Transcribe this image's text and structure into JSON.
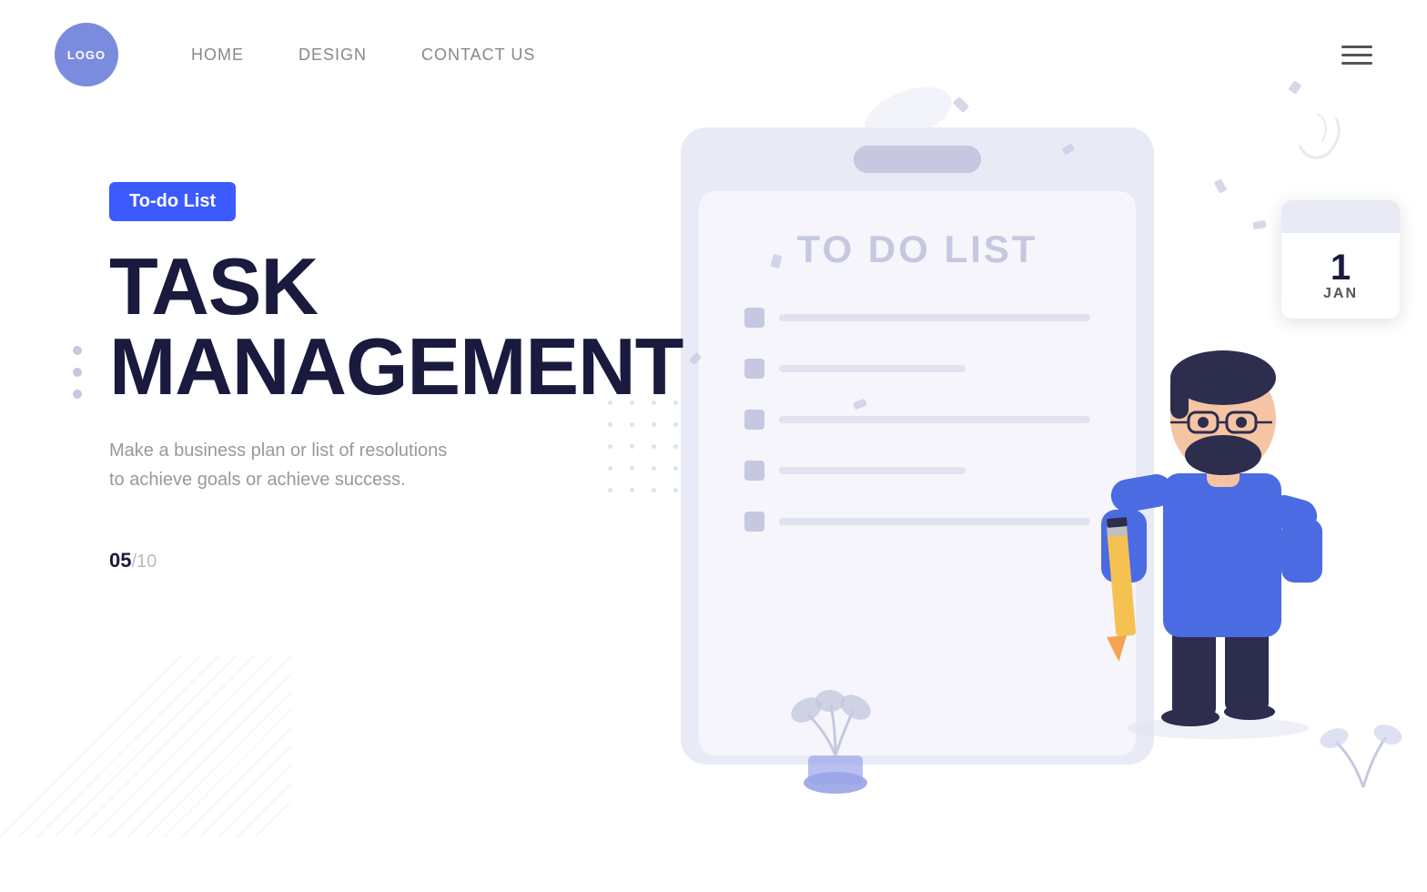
{
  "nav": {
    "logo": "LOGO",
    "links": [
      {
        "label": "HOME",
        "name": "home-link"
      },
      {
        "label": "DESIGN",
        "name": "design-link"
      },
      {
        "label": "CONTACT US",
        "name": "contact-link"
      }
    ]
  },
  "hero": {
    "badge": "To-do List",
    "title_line1": "TASK",
    "title_line2": "MANAGEMENT",
    "subtitle": "Make a business plan or list of resolutions to achieve goals or achieve success.",
    "pagination_current": "05",
    "pagination_total": "/10"
  },
  "illustration": {
    "clipboard_title": "TO DO LIST",
    "calendar_day": "1",
    "calendar_month": "JAN"
  },
  "colors": {
    "accent": "#3d5afe",
    "dark": "#1a1a3e",
    "light_purple": "#e8eaf6",
    "mid_purple": "#c5c8e0"
  }
}
